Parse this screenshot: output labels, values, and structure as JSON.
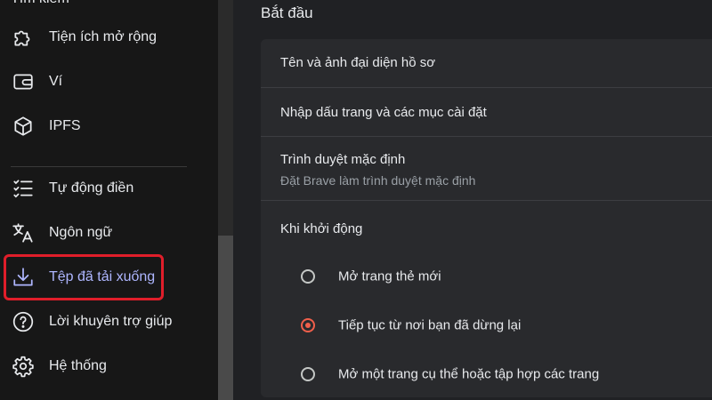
{
  "sidebar": {
    "top_cut_label": "Tìm kiếm",
    "items": [
      {
        "label": "Tiện ích mở rộng",
        "icon": "puzzle-icon"
      },
      {
        "label": "Ví",
        "icon": "wallet-icon"
      },
      {
        "label": "IPFS",
        "icon": "cube-icon"
      },
      {
        "label": "Tự động điền",
        "icon": "checklist-icon"
      },
      {
        "label": "Ngôn ngữ",
        "icon": "translate-icon"
      },
      {
        "label": "Tệp đã tải xuống",
        "icon": "download-icon",
        "active": true
      },
      {
        "label": "Lời khuyên trợ giúp",
        "icon": "help-icon"
      },
      {
        "label": "Hệ thống",
        "icon": "gear-icon"
      }
    ]
  },
  "main": {
    "section_title": "Bắt đầu",
    "rows": {
      "profile": "Tên và ảnh đại diện hồ sơ",
      "import": "Nhập dấu trang và các mục cài đặt",
      "default_browser_title": "Trình duyệt mặc định",
      "default_browser_sub": "Đặt Brave làm trình duyệt mặc định",
      "startup_title": "Khi khởi động"
    },
    "startup_options": [
      {
        "label": "Mở trang thẻ mới",
        "checked": false
      },
      {
        "label": "Tiếp tục từ nơi bạn đã dừng lại",
        "checked": true
      },
      {
        "label": "Mở một trang cụ thể hoặc tập hợp các trang",
        "checked": false
      }
    ]
  },
  "colors": {
    "accent": "#aeb6ff",
    "radio_checked": "#f05f4b",
    "highlight": "#e01e2a"
  }
}
